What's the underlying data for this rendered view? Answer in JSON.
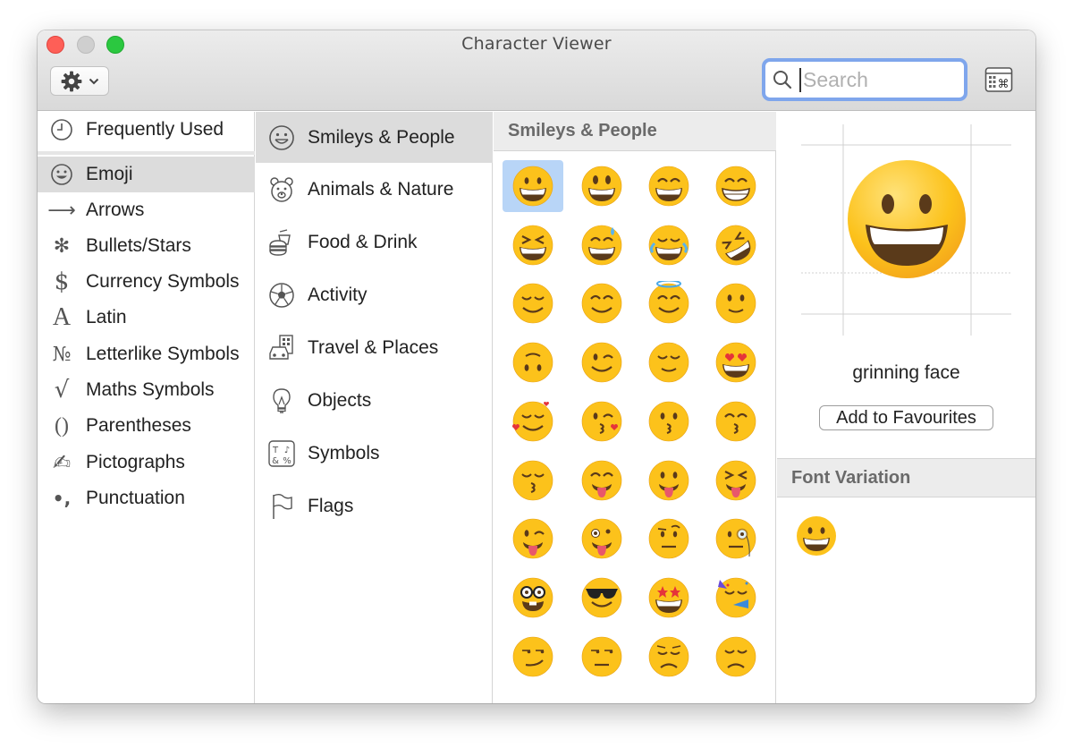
{
  "window": {
    "title": "Character Viewer"
  },
  "search": {
    "placeholder": "Search",
    "value": ""
  },
  "icons": {
    "action": "gear-icon",
    "search": "magnifier-icon",
    "keyboard": "keyboard-viewer-icon"
  },
  "colors": {
    "selection": "#b8d5f7",
    "sidebar_selected": "#dcdcdc",
    "search_focus": "#7fa6ec"
  },
  "categories": [
    {
      "label": "Frequently Used",
      "icon": "clock-icon",
      "glyph": ""
    },
    {
      "label": "Emoji",
      "icon": "smiley-icon",
      "glyph": "",
      "selected": true
    },
    {
      "label": "Arrows",
      "icon": "arrow-icon",
      "glyph": "⟶"
    },
    {
      "label": "Bullets/Stars",
      "icon": "asterisk-icon",
      "glyph": "✻"
    },
    {
      "label": "Currency Symbols",
      "icon": "dollar-icon",
      "glyph": "$"
    },
    {
      "label": "Latin",
      "icon": "letter-a-icon",
      "glyph": "A"
    },
    {
      "label": "Letterlike Symbols",
      "icon": "numero-icon",
      "glyph": "№"
    },
    {
      "label": "Maths Symbols",
      "icon": "square-root-icon",
      "glyph": "√"
    },
    {
      "label": "Parentheses",
      "icon": "parentheses-icon",
      "glyph": "()"
    },
    {
      "label": "Pictographs",
      "icon": "writing-hand-icon",
      "glyph": "✍"
    },
    {
      "label": "Punctuation",
      "icon": "punctuation-icon",
      "glyph": "•,"
    }
  ],
  "subcategories": [
    {
      "label": "Smileys & People",
      "icon": "smiley-outline-icon",
      "selected": true
    },
    {
      "label": "Animals & Nature",
      "icon": "bear-icon"
    },
    {
      "label": "Food & Drink",
      "icon": "burger-drink-icon"
    },
    {
      "label": "Activity",
      "icon": "soccer-ball-icon"
    },
    {
      "label": "Travel & Places",
      "icon": "car-building-icon"
    },
    {
      "label": "Objects",
      "icon": "light-bulb-icon"
    },
    {
      "label": "Symbols",
      "icon": "symbols-icon"
    },
    {
      "label": "Flags",
      "icon": "flag-icon"
    }
  ],
  "emoji_section": {
    "title": "Smileys & People",
    "items": [
      "grinning-face",
      "grinning-face-big-eyes",
      "grinning-face-smiling-eyes",
      "beaming-face",
      "grinning-squinting-face",
      "grinning-face-sweat",
      "face-tears-of-joy",
      "rolling-on-floor-laughing",
      "smiling-face",
      "smiling-face-smiling-eyes",
      "smiling-face-halo",
      "slightly-smiling-face",
      "upside-down-face",
      "winking-face",
      "relieved-face",
      "heart-eyes-face",
      "smiling-face-hearts",
      "face-blowing-kiss",
      "kissing-face",
      "kissing-face-smiling-eyes",
      "kissing-face-closed-eyes",
      "face-savoring-food",
      "face-with-tongue",
      "squinting-face-tongue",
      "winking-face-tongue",
      "zany-face",
      "face-raised-eyebrow",
      "face-with-monocle",
      "nerd-face",
      "smiling-face-sunglasses",
      "star-struck",
      "partying-face",
      "smirking-face",
      "unamused-face",
      "disappointed-face",
      "pensive-face"
    ],
    "selected_index": 0
  },
  "preview": {
    "name": "grinning face",
    "add_button_label": "Add to Favourites",
    "font_variation_title": "Font Variation"
  }
}
